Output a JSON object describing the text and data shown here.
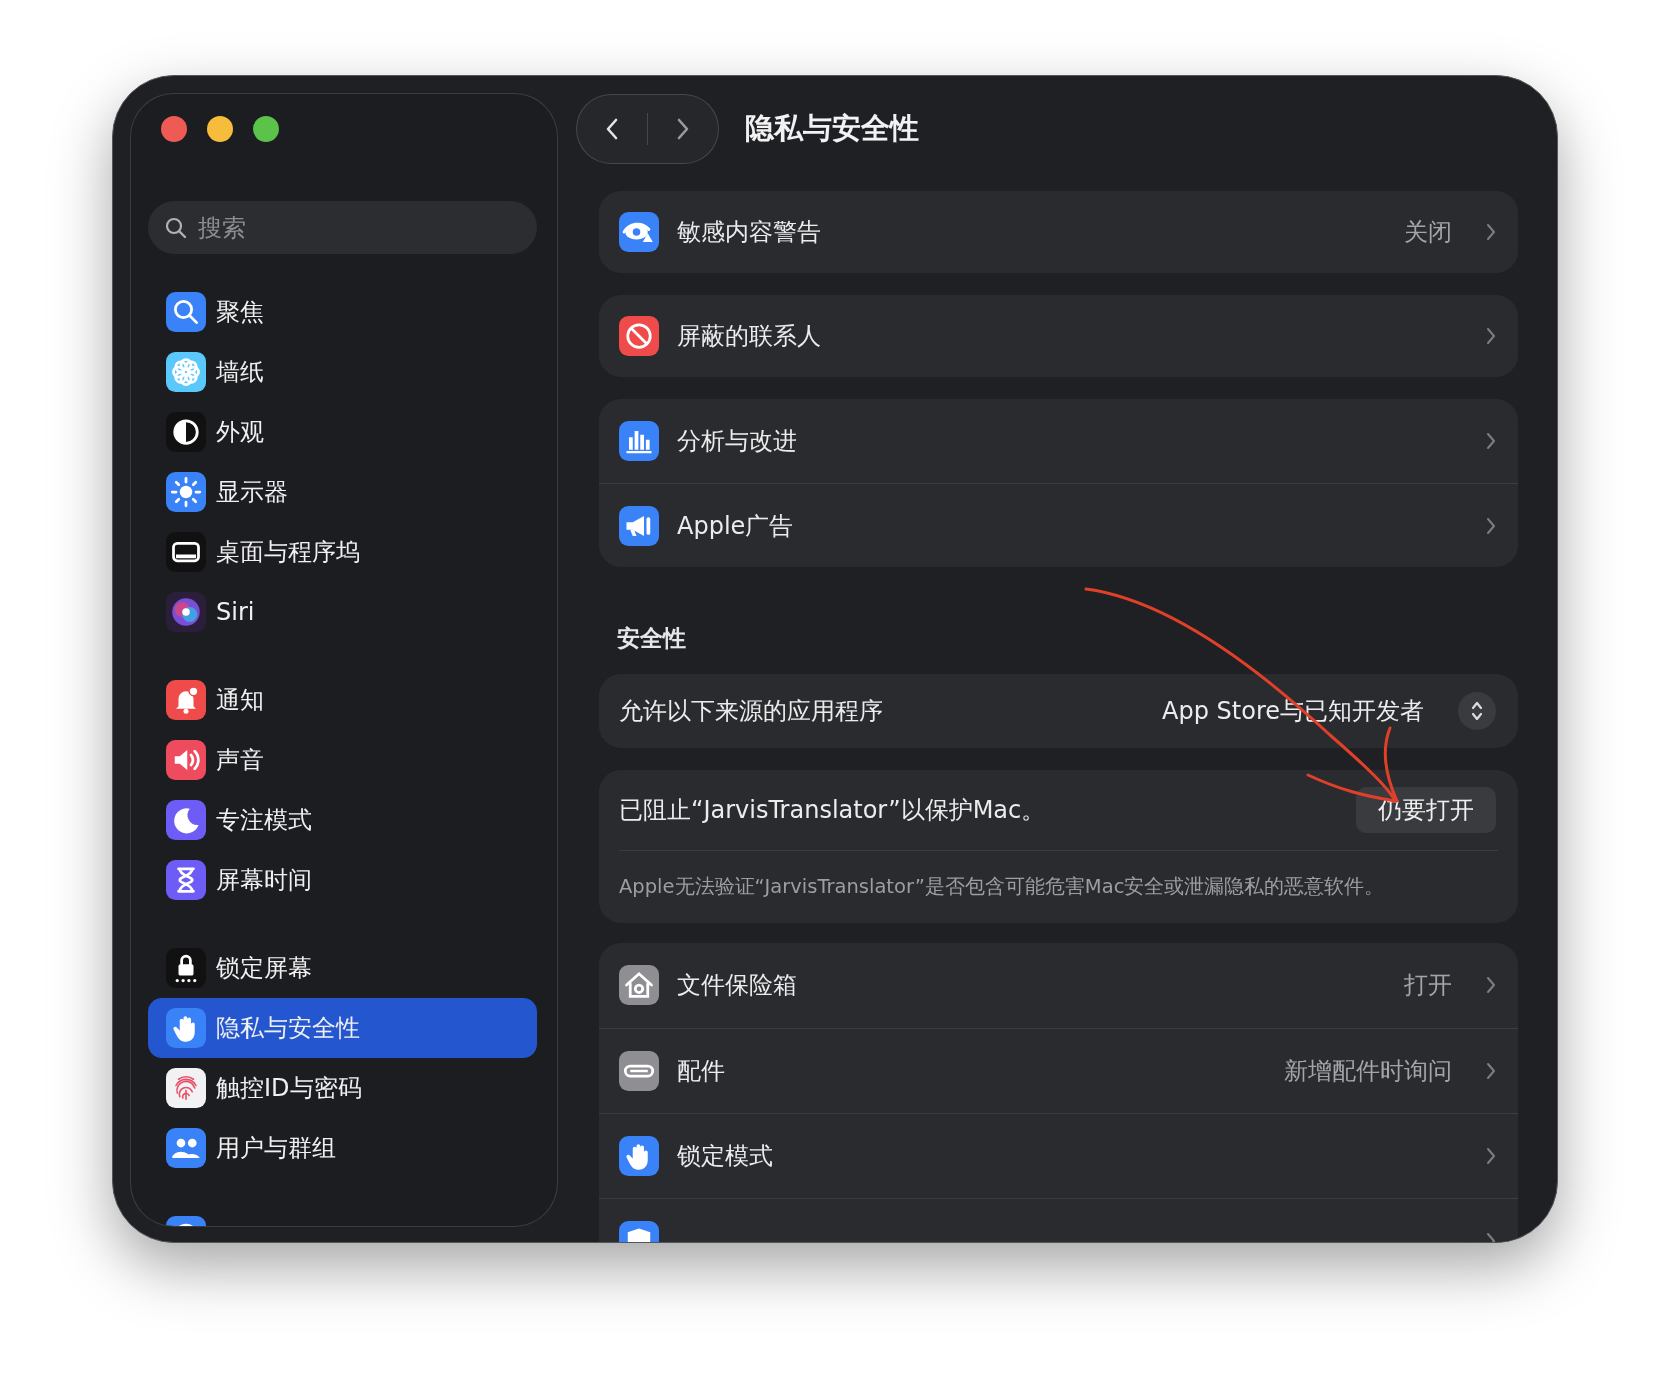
{
  "sidebar": {
    "search": {
      "placeholder": "搜索"
    },
    "groups": [
      {
        "items": [
          {
            "label": "聚焦",
            "selected": false
          },
          {
            "label": "墙纸",
            "selected": false
          },
          {
            "label": "外观",
            "selected": false
          },
          {
            "label": "显示器",
            "selected": false
          },
          {
            "label": "桌面与程序坞",
            "selected": false
          },
          {
            "label": "Siri",
            "selected": false
          }
        ]
      },
      {
        "items": [
          {
            "label": "通知",
            "selected": false
          },
          {
            "label": "声音",
            "selected": false
          },
          {
            "label": "专注模式",
            "selected": false
          },
          {
            "label": "屏幕时间",
            "selected": false
          }
        ]
      },
      {
        "items": [
          {
            "label": "锁定屏幕",
            "selected": false
          },
          {
            "label": "隐私与安全性",
            "selected": true
          },
          {
            "label": "触控ID与密码",
            "selected": false
          },
          {
            "label": "用户与群组",
            "selected": false
          }
        ]
      },
      {
        "items": [
          {
            "selected": false
          }
        ]
      }
    ]
  },
  "main": {
    "title": "隐私与安全性",
    "groups": [
      {
        "rows": [
          {
            "label": "敏感内容警告",
            "value": "关闭"
          }
        ]
      },
      {
        "rows": [
          {
            "label": "屏蔽的联系人"
          }
        ]
      },
      {
        "rows": [
          {
            "label": "分析与改进"
          },
          {
            "label": "Apple广告"
          }
        ]
      }
    ],
    "security": {
      "heading": "安全性",
      "allow_apps": {
        "label": "允许以下来源的应用程序",
        "value": "App Store与已知开发者"
      },
      "blocked": {
        "message": "已阻止“JarvisTranslator”以保护Mac。",
        "button": "仍要打开",
        "note": "Apple无法验证“JarvisTranslator”是否包含可能危害Mac安全或泄漏隐私的恶意软件。"
      },
      "rows": [
        {
          "label": "文件保险箱",
          "value": "打开"
        },
        {
          "label": "配件",
          "value": "新增配件时询问"
        },
        {
          "label": "锁定模式"
        },
        {}
      ]
    }
  }
}
